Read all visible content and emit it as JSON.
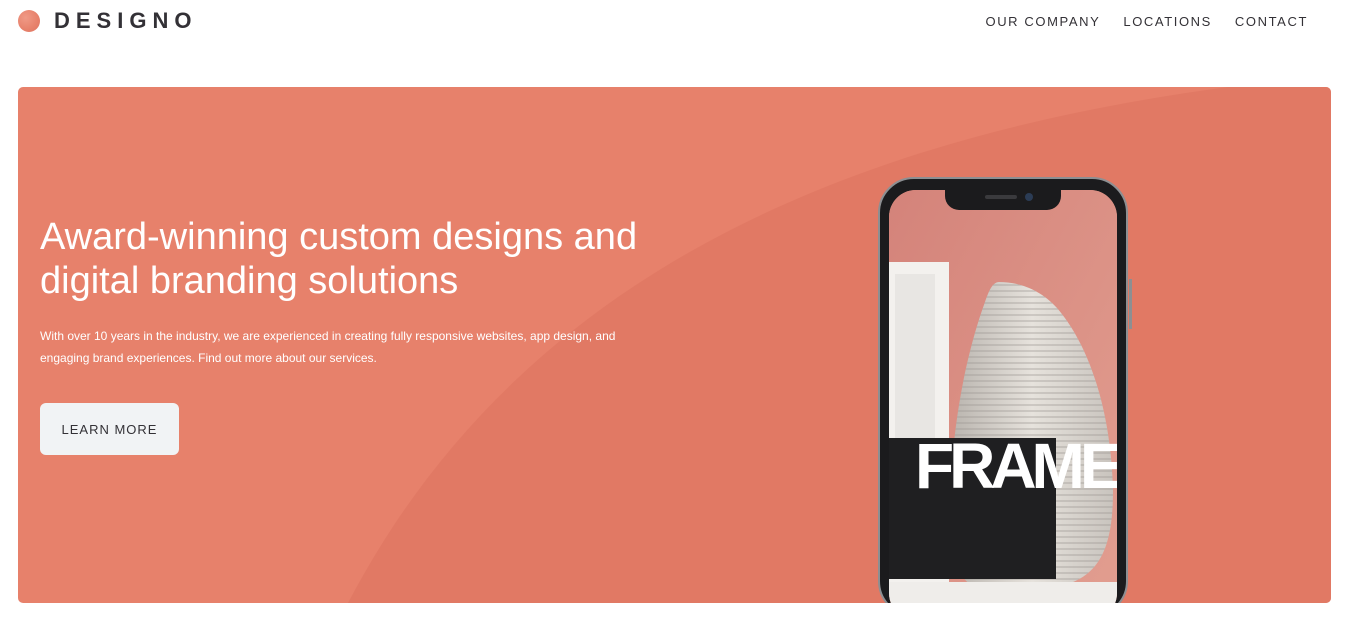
{
  "header": {
    "logo_text": "DESIGNO",
    "nav": [
      {
        "label": "OUR COMPANY"
      },
      {
        "label": "LOCATIONS"
      },
      {
        "label": "CONTACT"
      }
    ]
  },
  "hero": {
    "title_line1": "Award-winning custom designs and",
    "title_line2": "digital branding solutions",
    "description_line1": "With over 10 years in the industry, we are experienced in creating fully responsive websites, app design, and",
    "description_line2": "engaging brand experiences. Find out more about our services.",
    "button_label": "LEARN MORE",
    "phone_screen_text": "FRAME"
  },
  "colors": {
    "accent": "#e7816b",
    "accent_dark": "#dc7462",
    "text_dark": "#333136",
    "button_bg": "#f1f3f5"
  }
}
